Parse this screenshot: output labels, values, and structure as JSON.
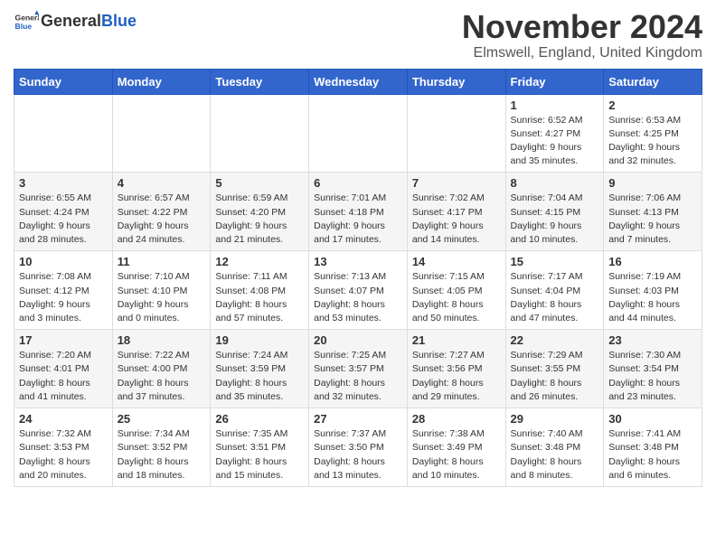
{
  "header": {
    "logo_general": "General",
    "logo_blue": "Blue",
    "month_title": "November 2024",
    "location": "Elmswell, England, United Kingdom"
  },
  "weekdays": [
    "Sunday",
    "Monday",
    "Tuesday",
    "Wednesday",
    "Thursday",
    "Friday",
    "Saturday"
  ],
  "weeks": [
    [
      {
        "day": "",
        "info": ""
      },
      {
        "day": "",
        "info": ""
      },
      {
        "day": "",
        "info": ""
      },
      {
        "day": "",
        "info": ""
      },
      {
        "day": "",
        "info": ""
      },
      {
        "day": "1",
        "info": "Sunrise: 6:52 AM\nSunset: 4:27 PM\nDaylight: 9 hours and 35 minutes."
      },
      {
        "day": "2",
        "info": "Sunrise: 6:53 AM\nSunset: 4:25 PM\nDaylight: 9 hours and 32 minutes."
      }
    ],
    [
      {
        "day": "3",
        "info": "Sunrise: 6:55 AM\nSunset: 4:24 PM\nDaylight: 9 hours and 28 minutes."
      },
      {
        "day": "4",
        "info": "Sunrise: 6:57 AM\nSunset: 4:22 PM\nDaylight: 9 hours and 24 minutes."
      },
      {
        "day": "5",
        "info": "Sunrise: 6:59 AM\nSunset: 4:20 PM\nDaylight: 9 hours and 21 minutes."
      },
      {
        "day": "6",
        "info": "Sunrise: 7:01 AM\nSunset: 4:18 PM\nDaylight: 9 hours and 17 minutes."
      },
      {
        "day": "7",
        "info": "Sunrise: 7:02 AM\nSunset: 4:17 PM\nDaylight: 9 hours and 14 minutes."
      },
      {
        "day": "8",
        "info": "Sunrise: 7:04 AM\nSunset: 4:15 PM\nDaylight: 9 hours and 10 minutes."
      },
      {
        "day": "9",
        "info": "Sunrise: 7:06 AM\nSunset: 4:13 PM\nDaylight: 9 hours and 7 minutes."
      }
    ],
    [
      {
        "day": "10",
        "info": "Sunrise: 7:08 AM\nSunset: 4:12 PM\nDaylight: 9 hours and 3 minutes."
      },
      {
        "day": "11",
        "info": "Sunrise: 7:10 AM\nSunset: 4:10 PM\nDaylight: 9 hours and 0 minutes."
      },
      {
        "day": "12",
        "info": "Sunrise: 7:11 AM\nSunset: 4:08 PM\nDaylight: 8 hours and 57 minutes."
      },
      {
        "day": "13",
        "info": "Sunrise: 7:13 AM\nSunset: 4:07 PM\nDaylight: 8 hours and 53 minutes."
      },
      {
        "day": "14",
        "info": "Sunrise: 7:15 AM\nSunset: 4:05 PM\nDaylight: 8 hours and 50 minutes."
      },
      {
        "day": "15",
        "info": "Sunrise: 7:17 AM\nSunset: 4:04 PM\nDaylight: 8 hours and 47 minutes."
      },
      {
        "day": "16",
        "info": "Sunrise: 7:19 AM\nSunset: 4:03 PM\nDaylight: 8 hours and 44 minutes."
      }
    ],
    [
      {
        "day": "17",
        "info": "Sunrise: 7:20 AM\nSunset: 4:01 PM\nDaylight: 8 hours and 41 minutes."
      },
      {
        "day": "18",
        "info": "Sunrise: 7:22 AM\nSunset: 4:00 PM\nDaylight: 8 hours and 37 minutes."
      },
      {
        "day": "19",
        "info": "Sunrise: 7:24 AM\nSunset: 3:59 PM\nDaylight: 8 hours and 35 minutes."
      },
      {
        "day": "20",
        "info": "Sunrise: 7:25 AM\nSunset: 3:57 PM\nDaylight: 8 hours and 32 minutes."
      },
      {
        "day": "21",
        "info": "Sunrise: 7:27 AM\nSunset: 3:56 PM\nDaylight: 8 hours and 29 minutes."
      },
      {
        "day": "22",
        "info": "Sunrise: 7:29 AM\nSunset: 3:55 PM\nDaylight: 8 hours and 26 minutes."
      },
      {
        "day": "23",
        "info": "Sunrise: 7:30 AM\nSunset: 3:54 PM\nDaylight: 8 hours and 23 minutes."
      }
    ],
    [
      {
        "day": "24",
        "info": "Sunrise: 7:32 AM\nSunset: 3:53 PM\nDaylight: 8 hours and 20 minutes."
      },
      {
        "day": "25",
        "info": "Sunrise: 7:34 AM\nSunset: 3:52 PM\nDaylight: 8 hours and 18 minutes."
      },
      {
        "day": "26",
        "info": "Sunrise: 7:35 AM\nSunset: 3:51 PM\nDaylight: 8 hours and 15 minutes."
      },
      {
        "day": "27",
        "info": "Sunrise: 7:37 AM\nSunset: 3:50 PM\nDaylight: 8 hours and 13 minutes."
      },
      {
        "day": "28",
        "info": "Sunrise: 7:38 AM\nSunset: 3:49 PM\nDaylight: 8 hours and 10 minutes."
      },
      {
        "day": "29",
        "info": "Sunrise: 7:40 AM\nSunset: 3:48 PM\nDaylight: 8 hours and 8 minutes."
      },
      {
        "day": "30",
        "info": "Sunrise: 7:41 AM\nSunset: 3:48 PM\nDaylight: 8 hours and 6 minutes."
      }
    ]
  ]
}
